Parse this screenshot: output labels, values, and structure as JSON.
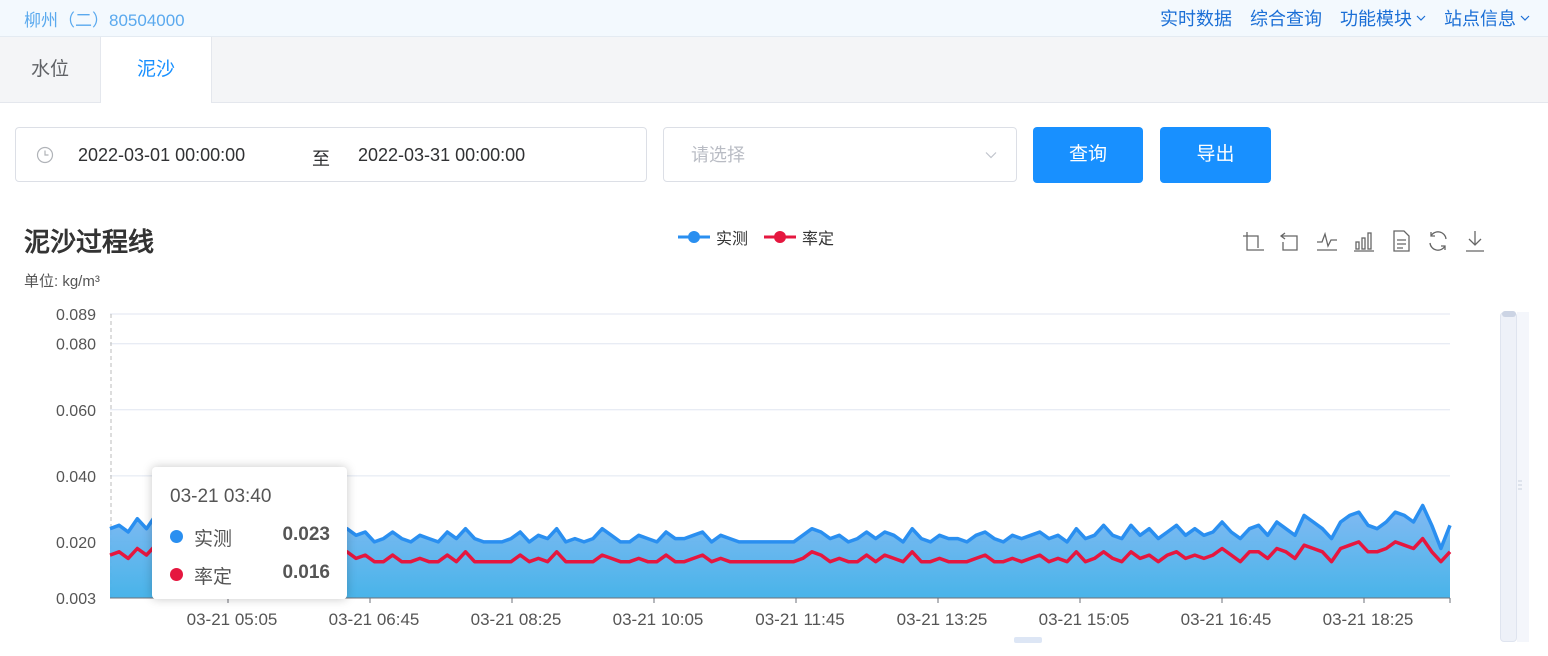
{
  "header": {
    "station": "柳州（二）80504000",
    "nav": [
      {
        "label": "实时数据",
        "dropdown": false
      },
      {
        "label": "综合查询",
        "dropdown": false
      },
      {
        "label": "功能模块",
        "dropdown": true
      },
      {
        "label": "站点信息",
        "dropdown": true
      }
    ]
  },
  "tabs": [
    {
      "label": "水位",
      "active": false
    },
    {
      "label": "泥沙",
      "active": true
    }
  ],
  "filters": {
    "start": "2022-03-01 00:00:00",
    "separator": "至",
    "end": "2022-03-31 00:00:00",
    "select_placeholder": "请选择",
    "query_label": "查询",
    "export_label": "导出"
  },
  "chart_data": {
    "type": "area",
    "title": "泥沙过程线",
    "ylabel": "单位: kg/m³",
    "xlabel": "",
    "ylim": [
      0.003,
      0.089
    ],
    "yticks": [
      "0.003",
      "0.020",
      "0.040",
      "0.060",
      "0.080",
      "0.089"
    ],
    "grid": true,
    "legend": "top-center",
    "xticks": [
      "03-21 05:05",
      "03-21 06:45",
      "03-21 08:25",
      "03-21 10:05",
      "03-21 11:45",
      "03-21 13:25",
      "03-21 15:05",
      "03-21 16:45",
      "03-21 18:25"
    ],
    "series": [
      {
        "name": "实测",
        "color": "#2a8ff0",
        "values": [
          0.024,
          0.025,
          0.023,
          0.027,
          0.024,
          0.028,
          0.03,
          0.027,
          0.025,
          0.026,
          0.024,
          0.026,
          0.027,
          0.025,
          0.026,
          0.024,
          0.025,
          0.023,
          0.025,
          0.022,
          0.024,
          0.022,
          0.023,
          0.021,
          0.02,
          0.022,
          0.024,
          0.022,
          0.023,
          0.02,
          0.021,
          0.023,
          0.021,
          0.02,
          0.022,
          0.021,
          0.02,
          0.023,
          0.021,
          0.024,
          0.021,
          0.02,
          0.02,
          0.02,
          0.021,
          0.023,
          0.02,
          0.022,
          0.021,
          0.024,
          0.02,
          0.021,
          0.02,
          0.021,
          0.024,
          0.022,
          0.02,
          0.02,
          0.022,
          0.021,
          0.02,
          0.023,
          0.021,
          0.021,
          0.022,
          0.023,
          0.02,
          0.022,
          0.021,
          0.02,
          0.02,
          0.02,
          0.02,
          0.02,
          0.02,
          0.02,
          0.022,
          0.024,
          0.023,
          0.021,
          0.022,
          0.02,
          0.021,
          0.023,
          0.021,
          0.023,
          0.022,
          0.02,
          0.024,
          0.021,
          0.02,
          0.022,
          0.021,
          0.021,
          0.02,
          0.022,
          0.023,
          0.021,
          0.02,
          0.022,
          0.021,
          0.022,
          0.023,
          0.021,
          0.022,
          0.02,
          0.024,
          0.021,
          0.022,
          0.025,
          0.022,
          0.021,
          0.025,
          0.022,
          0.024,
          0.021,
          0.023,
          0.025,
          0.022,
          0.024,
          0.022,
          0.023,
          0.026,
          0.023,
          0.021,
          0.024,
          0.025,
          0.022,
          0.026,
          0.024,
          0.022,
          0.028,
          0.026,
          0.024,
          0.021,
          0.026,
          0.028,
          0.029,
          0.025,
          0.024,
          0.026,
          0.029,
          0.028,
          0.026,
          0.031,
          0.025,
          0.018,
          0.025
        ]
      },
      {
        "name": "率定",
        "color": "#e5173f",
        "values": [
          0.016,
          0.017,
          0.015,
          0.018,
          0.016,
          0.019,
          0.022,
          0.02,
          0.018,
          0.019,
          0.017,
          0.019,
          0.018,
          0.017,
          0.018,
          0.016,
          0.017,
          0.016,
          0.017,
          0.015,
          0.016,
          0.015,
          0.016,
          0.014,
          0.014,
          0.015,
          0.017,
          0.015,
          0.016,
          0.014,
          0.014,
          0.016,
          0.014,
          0.014,
          0.015,
          0.014,
          0.014,
          0.016,
          0.014,
          0.017,
          0.014,
          0.014,
          0.014,
          0.014,
          0.014,
          0.016,
          0.014,
          0.015,
          0.014,
          0.017,
          0.014,
          0.014,
          0.014,
          0.014,
          0.016,
          0.015,
          0.014,
          0.014,
          0.015,
          0.014,
          0.014,
          0.016,
          0.014,
          0.014,
          0.015,
          0.016,
          0.014,
          0.015,
          0.014,
          0.014,
          0.014,
          0.014,
          0.014,
          0.014,
          0.014,
          0.014,
          0.015,
          0.017,
          0.016,
          0.014,
          0.015,
          0.014,
          0.014,
          0.016,
          0.014,
          0.016,
          0.015,
          0.014,
          0.017,
          0.014,
          0.014,
          0.015,
          0.014,
          0.014,
          0.014,
          0.015,
          0.016,
          0.014,
          0.014,
          0.015,
          0.014,
          0.015,
          0.016,
          0.014,
          0.015,
          0.014,
          0.017,
          0.014,
          0.015,
          0.017,
          0.015,
          0.014,
          0.017,
          0.015,
          0.016,
          0.014,
          0.016,
          0.017,
          0.015,
          0.016,
          0.015,
          0.016,
          0.018,
          0.016,
          0.014,
          0.017,
          0.017,
          0.015,
          0.018,
          0.017,
          0.015,
          0.019,
          0.018,
          0.017,
          0.014,
          0.018,
          0.019,
          0.02,
          0.017,
          0.017,
          0.018,
          0.02,
          0.019,
          0.018,
          0.021,
          0.017,
          0.014,
          0.017
        ]
      }
    ],
    "tooltip": {
      "time": "03-21 03:40",
      "rows": [
        {
          "name": "实测",
          "value": "0.023",
          "color": "#2a8ff0"
        },
        {
          "name": "率定",
          "value": "0.016",
          "color": "#e5173f"
        }
      ]
    }
  }
}
